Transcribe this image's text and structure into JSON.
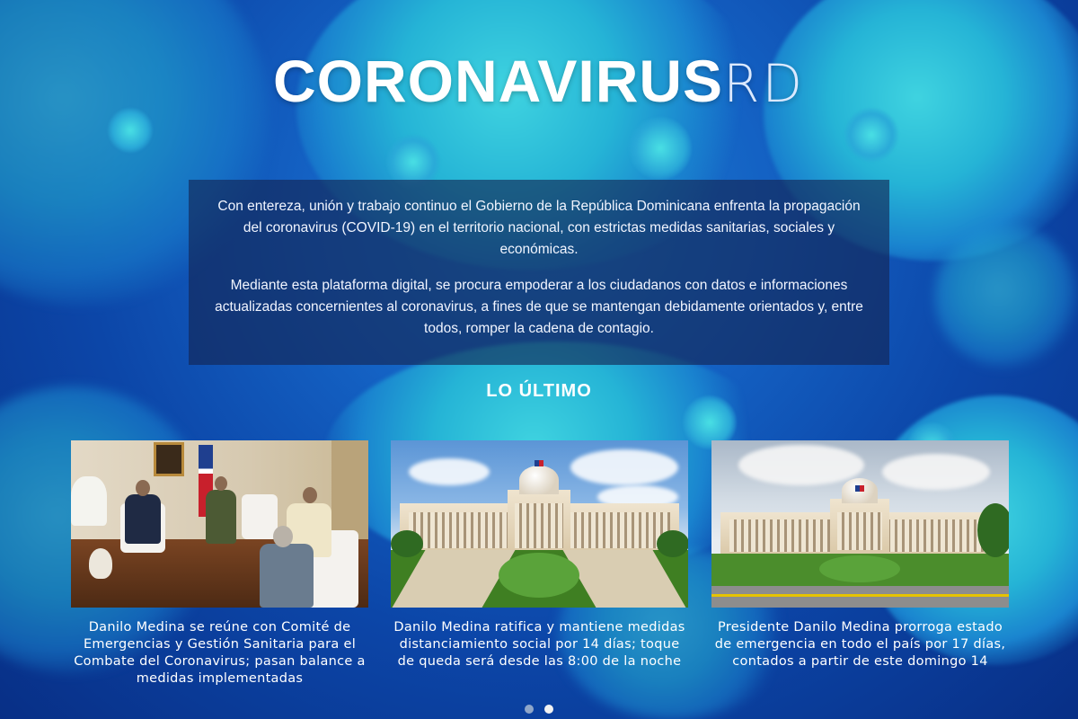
{
  "header": {
    "title_strong": "CORONAVIRUS",
    "title_light": "RD"
  },
  "intro": {
    "paragraph1": "Con entereza, unión y trabajo continuo el Gobierno de la República Dominicana enfrenta la propagación del coronavirus (COVID-19) en el territorio nacional, con estrictas medidas sanitarias, sociales y económicas.",
    "paragraph2": "Mediante esta plataforma digital, se procura empoderar a los ciudadanos con datos e informaciones actualizadas concernientes al coronavirus, a fines de que se mantengan debidamente orientados y, entre todos, romper la cadena de contagio."
  },
  "latest": {
    "heading": "LO ÚLTIMO",
    "cards": [
      {
        "caption": "Danilo Medina se reúne con Comité de Emergencias y Gestión Sanitaria para el Combate del Coronavirus; pasan balance a medidas implementadas"
      },
      {
        "caption": "Danilo Medina ratifica y mantiene medidas distanciamiento social por 14 días; toque de queda será desde las 8:00 de la noche"
      },
      {
        "caption": "Presidente Danilo Medina prorroga estado de emergencia en todo el país por 17 días, contados a partir de este domingo 14"
      }
    ]
  },
  "carousel": {
    "page_count": 2,
    "active_page": 2
  },
  "colors": {
    "background": "#0b3fa0",
    "panel": "rgba(20,35,80,0.62)",
    "text": "#ffffff"
  }
}
